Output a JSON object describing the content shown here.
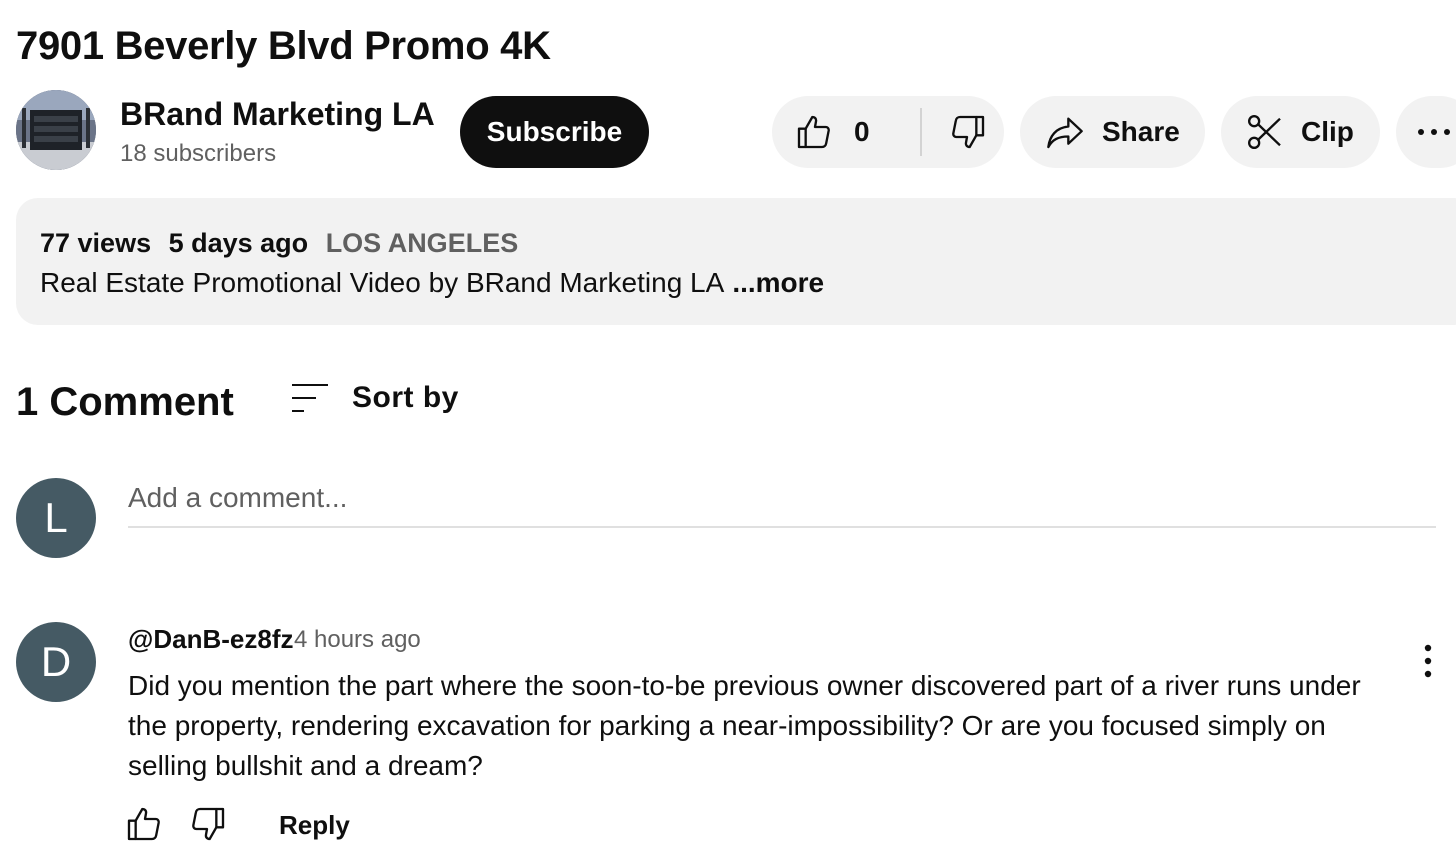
{
  "video": {
    "title": "7901 Beverly Blvd Promo 4K"
  },
  "channel": {
    "name": "BRand Marketing LA",
    "subscribers": "18 subscribers",
    "subscribe_label": "Subscribe"
  },
  "actions": {
    "like_count": "0",
    "share_label": "Share",
    "clip_label": "Clip"
  },
  "description": {
    "views": "77 views",
    "posted": "5 days ago",
    "location": "LOS ANGELES",
    "text": "Real Estate Promotional Video by BRand Marketing LA",
    "more_label": "...more"
  },
  "comments": {
    "count_label": "1 Comment",
    "sort_label": "Sort by",
    "current_user_initial": "L",
    "add_placeholder": "Add a comment...",
    "items": [
      {
        "initial": "D",
        "author": "@DanB-ez8fz",
        "time": "4 hours ago",
        "text": "Did you mention the part where the soon-to-be previous owner discovered part of a river runs under the property, rendering excavation for parking a near-impossibility? Or are you focused simply on selling bullshit and a dream?",
        "reply_label": "Reply"
      }
    ]
  },
  "icons": {
    "like": "thumb-up-icon",
    "dislike": "thumb-down-icon",
    "share": "share-arrow-icon",
    "clip": "scissors-icon",
    "more": "more-horizontal-icon",
    "sort": "sort-icon",
    "comment_menu": "more-vertical-icon"
  },
  "colors": {
    "text": "#0f0f0f",
    "secondary_text": "#606060",
    "pill_background": "#f2f2f2",
    "subscribe_background": "#0f0f0f",
    "avatar_background": "#455a64"
  }
}
